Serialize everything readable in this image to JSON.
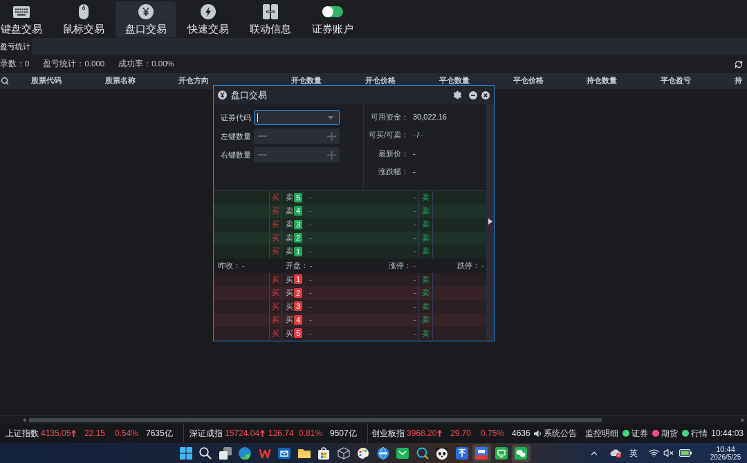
{
  "toolbar": [
    {
      "kind": "keyboard",
      "label": "键盘交易",
      "selected": false
    },
    {
      "kind": "mouse",
      "label": "鼠标交易",
      "selected": false
    },
    {
      "kind": "yen",
      "label": "盘口交易",
      "selected": true
    },
    {
      "kind": "bolt",
      "label": "快速交易",
      "selected": false
    },
    {
      "kind": "panels",
      "label": "联动信息",
      "selected": false
    },
    {
      "kind": "toggle",
      "label": "证券账户",
      "selected": false
    }
  ],
  "tabs": [
    {
      "label": "盈亏统计",
      "selected": true
    }
  ],
  "summary": [
    {
      "label": "录数：",
      "value": "0"
    },
    {
      "label": "盈亏统计：",
      "value": "0.000"
    },
    {
      "label": "成功率：",
      "value": "0.00%"
    }
  ],
  "table": {
    "columns": [
      "股票代码",
      "股票名称",
      "开仓方向",
      "开仓数量",
      "开仓价格",
      "平仓数量",
      "平仓价格",
      "持仓数量",
      "平仓盈亏",
      "持"
    ]
  },
  "dialog": {
    "title": "盘口交易",
    "form": [
      {
        "kind": "combo",
        "label": "证券代码",
        "focused": true
      },
      {
        "kind": "stepper",
        "label": "左键数量"
      },
      {
        "kind": "stepper",
        "label": "右键数量"
      }
    ],
    "account": [
      {
        "kind": "value",
        "label": "可用资金：",
        "value": "30,022.16"
      },
      {
        "kind": "split",
        "label": "可买/可卖：",
        "value": "-",
        "separator": "/",
        "value_2": "-"
      },
      {
        "kind": "value",
        "label": "最新价：",
        "value": "-"
      },
      {
        "kind": "value",
        "label": "涨跌幅：",
        "value": "-"
      }
    ],
    "asks": [
      {
        "buy": "买",
        "label": "卖",
        "rank": "5",
        "value_1": "-",
        "value_2": "-",
        "sell": "卖"
      },
      {
        "buy": "买",
        "label": "卖",
        "rank": "4",
        "value_1": "-",
        "value_2": "-",
        "sell": "卖"
      },
      {
        "buy": "买",
        "label": "卖",
        "rank": "3",
        "value_1": "-",
        "value_2": "-",
        "sell": "卖"
      },
      {
        "buy": "买",
        "label": "卖",
        "rank": "2",
        "value_1": "-",
        "value_2": "-",
        "sell": "卖"
      },
      {
        "buy": "买",
        "label": "卖",
        "rank": "1",
        "value_1": "-",
        "value_2": "-",
        "sell": "卖"
      }
    ],
    "quote": [
      {
        "kind": "plain",
        "label": "昨收：",
        "value": "-"
      },
      {
        "kind": "plain",
        "label": "开盘：",
        "value": "-"
      },
      {
        "kind": "up",
        "label": "涨停：",
        "value": "-"
      },
      {
        "kind": "down",
        "label": "跌停：",
        "value": "-"
      }
    ],
    "bids": [
      {
        "buy": "买",
        "label": "买",
        "rank": "1",
        "value_1": "-",
        "value_2": "-",
        "sell": "卖"
      },
      {
        "buy": "买",
        "label": "买",
        "rank": "2",
        "value_1": "-",
        "value_2": "-",
        "sell": "卖"
      },
      {
        "buy": "买",
        "label": "买",
        "rank": "3",
        "value_1": "-",
        "value_2": "-",
        "sell": "卖"
      },
      {
        "buy": "买",
        "label": "买",
        "rank": "4",
        "value_1": "-",
        "value_2": "-",
        "sell": "卖"
      },
      {
        "buy": "买",
        "label": "买",
        "rank": "5",
        "value_1": "-",
        "value_2": "-",
        "sell": "卖"
      }
    ]
  },
  "indices": [
    {
      "kind": "up",
      "name": "上证指数",
      "value": "4135.05",
      "change": "22.15",
      "percent": "0.54%",
      "turnover": "7635亿"
    },
    {
      "kind": "up",
      "name": "深证成指",
      "value": "15724.04",
      "change": "126.74",
      "percent": "0.81%",
      "turnover": "9507亿"
    },
    {
      "kind": "up",
      "name": "创业板指",
      "value": "3968.20",
      "change": "29.70",
      "percent": "0.75%",
      "turnover": "4636"
    }
  ],
  "status": {
    "notice": "系统公告",
    "monitor": "监控明细",
    "connections": [
      {
        "label": "证券",
        "color": "#3ed482"
      },
      {
        "label": "期货",
        "color": "#f0507f"
      },
      {
        "label": "行情",
        "color": "#3ed482"
      }
    ],
    "clock": "10:44:03"
  },
  "taskbar": {
    "apps": [
      {
        "kind": "start",
        "active": false
      },
      {
        "kind": "search",
        "active": false
      },
      {
        "kind": "taskview",
        "active": false
      },
      {
        "kind": "swirl",
        "active": false
      },
      {
        "kind": "zigzag",
        "active": false
      },
      {
        "kind": "mailtile",
        "active": false
      },
      {
        "kind": "folder",
        "active": false
      },
      {
        "kind": "bag",
        "active": false
      },
      {
        "kind": "cube",
        "active": false
      },
      {
        "kind": "palette",
        "active": false
      },
      {
        "kind": "globe",
        "active": false
      },
      {
        "kind": "chevrontile",
        "active": false
      },
      {
        "kind": "magnifier",
        "active": false
      },
      {
        "kind": "panda",
        "active": false
      },
      {
        "kind": "upload",
        "active": false
      },
      {
        "kind": "bannertile",
        "active": true
      },
      {
        "kind": "monitor",
        "active": false
      },
      {
        "kind": "bubbles",
        "active": true
      }
    ],
    "ime": "英",
    "time": "10:44",
    "date": "2026/5/25"
  }
}
